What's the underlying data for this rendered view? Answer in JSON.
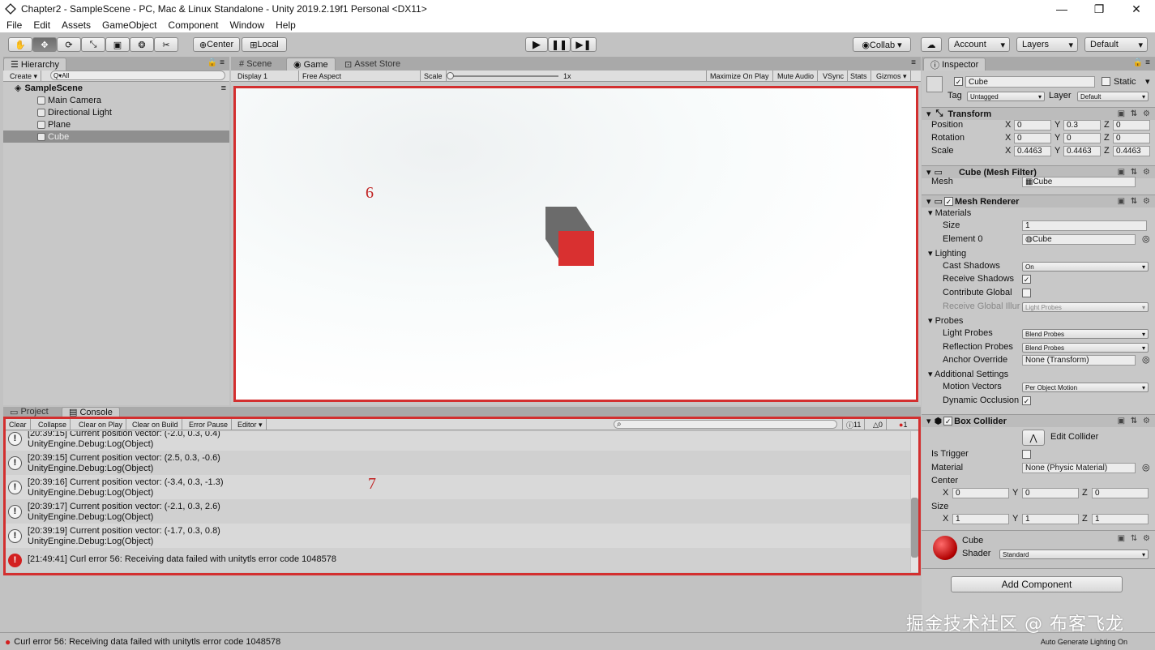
{
  "window": {
    "title": "Chapter2 - SampleScene - PC, Mac & Linux Standalone - Unity 2019.2.19f1 Personal <DX11>",
    "minimize": "—",
    "maximize": "❐",
    "close": "✕"
  },
  "menu": [
    "File",
    "Edit",
    "Assets",
    "GameObject",
    "Component",
    "Window",
    "Help"
  ],
  "toolbar": {
    "pivot_label": "Center",
    "space_label": "Local",
    "collab_label": "Collab ▾",
    "account_label": "Account",
    "layers_label": "Layers",
    "layout_label": "Default"
  },
  "hierarchy": {
    "tab": "Hierarchy",
    "create_label": "Create ▾",
    "search_placeholder": "Q▾All",
    "scene_name": "SampleScene",
    "items": [
      "Main Camera",
      "Directional Light",
      "Plane",
      "Cube"
    ]
  },
  "game": {
    "tabs": [
      "Scene",
      "Game",
      "Asset Store"
    ],
    "display": "Display 1",
    "aspect": "Free Aspect",
    "scale_label": "Scale",
    "scale_value": "1x",
    "buttons": [
      "Maximize On Play",
      "Mute Audio",
      "VSync",
      "Stats",
      "Gizmos ▾"
    ]
  },
  "console": {
    "tabs": [
      "Project",
      "Console"
    ],
    "toolbar": [
      "Clear",
      "Collapse",
      "Clear on Play",
      "Clear on Build",
      "Error Pause",
      "Editor ▾"
    ],
    "count_info": "11",
    "count_warn": "0",
    "count_err": "1",
    "logs": [
      {
        "line1": "[20:39:15] Current position vector: (-2.0, 0.3, 0.4)",
        "line2": "UnityEngine.Debug:Log(Object)",
        "type": "info"
      },
      {
        "line1": "[20:39:15] Current position vector: (2.5, 0.3, -0.6)",
        "line2": "UnityEngine.Debug:Log(Object)",
        "type": "info"
      },
      {
        "line1": "[20:39:16] Current position vector: (-3.4, 0.3, -1.3)",
        "line2": "UnityEngine.Debug:Log(Object)",
        "type": "info"
      },
      {
        "line1": "[20:39:17] Current position vector: (-2.1, 0.3, 2.6)",
        "line2": "UnityEngine.Debug:Log(Object)",
        "type": "info"
      },
      {
        "line1": "[20:39:19] Current position vector: (-1.7, 0.3, 0.8)",
        "line2": "UnityEngine.Debug:Log(Object)",
        "type": "info"
      },
      {
        "line1": "[21:49:41] Curl error 56: Receiving data failed with unitytls error code 1048578",
        "line2": "",
        "type": "error"
      }
    ]
  },
  "inspector": {
    "tab": "Inspector",
    "object_name": "Cube",
    "static_label": "Static",
    "tag_label": "Tag",
    "tag_value": "Untagged",
    "layer_label": "Layer",
    "layer_value": "Default",
    "transform": {
      "title": "Transform",
      "position_label": "Position",
      "rotation_label": "Rotation",
      "scale_label": "Scale",
      "position": [
        "0",
        "0.3",
        "0"
      ],
      "rotation": [
        "0",
        "0",
        "0"
      ],
      "scale": [
        "0.4463",
        "0.4463",
        "0.4463"
      ]
    },
    "mesh_filter": {
      "title": "Cube (Mesh Filter)",
      "mesh_label": "Mesh",
      "mesh_value": "Cube"
    },
    "mesh_renderer": {
      "title": "Mesh Renderer",
      "materials": "Materials",
      "size_label": "Size",
      "size_value": "1",
      "element_label": "Element 0",
      "element_value": "Cube",
      "lighting": "Lighting",
      "cast_shadows_label": "Cast Shadows",
      "cast_shadows_value": "On",
      "receive_shadows_label": "Receive Shadows",
      "contribute_gi_label": "Contribute Global",
      "receive_gi_label": "Receive Global Illur",
      "receive_gi_value": "Light Probes",
      "probes": "Probes",
      "light_probes_label": "Light Probes",
      "light_probes_value": "Blend Probes",
      "reflection_probes_label": "Reflection Probes",
      "reflection_probes_value": "Blend Probes",
      "anchor_override_label": "Anchor Override",
      "anchor_override_value": "None (Transform)",
      "additional": "Additional Settings",
      "motion_vectors_label": "Motion Vectors",
      "motion_vectors_value": "Per Object Motion",
      "dynamic_occlusion_label": "Dynamic Occlusion"
    },
    "box_collider": {
      "title": "Box Collider",
      "edit_collider": "Edit Collider",
      "is_trigger_label": "Is Trigger",
      "material_label": "Material",
      "material_value": "None (Physic Material)",
      "center_label": "Center",
      "center": [
        "0",
        "0",
        "0"
      ],
      "size_label": "Size",
      "size": [
        "1",
        "1",
        "1"
      ]
    },
    "material": {
      "name": "Cube",
      "shader_label": "Shader",
      "shader_value": "Standard"
    },
    "add_component": "Add Component"
  },
  "status": {
    "message": "Curl error 56: Receiving data failed with unitytls error code 1048578",
    "right": "Auto Generate Lighting On"
  },
  "annotations": {
    "game_number": "6",
    "console_number": "7"
  },
  "watermark": "掘金技术社区 @ 布客飞龙",
  "colors": {
    "highlight_red": "#d32f2f",
    "cube_red": "#d93030",
    "cube_grey": "#6b6b6b"
  }
}
